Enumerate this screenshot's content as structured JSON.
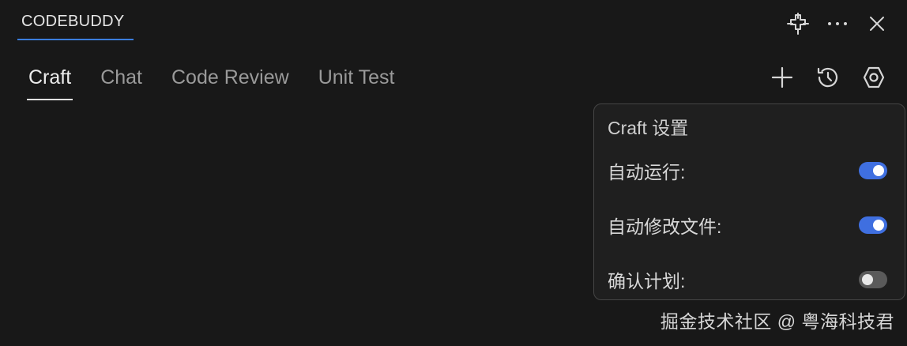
{
  "panel": {
    "title": "CODEBUDDY",
    "header_actions": [
      {
        "name": "agent-icon"
      },
      {
        "name": "more-icon"
      },
      {
        "name": "close-icon"
      }
    ]
  },
  "tabs": [
    {
      "label": "Craft",
      "active": true
    },
    {
      "label": "Chat",
      "active": false
    },
    {
      "label": "Code Review",
      "active": false
    },
    {
      "label": "Unit Test",
      "active": false
    }
  ],
  "toolbar": {
    "actions": [
      "add-icon",
      "history-icon",
      "settings-icon"
    ]
  },
  "settings_popup": {
    "title": "Craft 设置",
    "items": [
      {
        "label": "自动运行:",
        "enabled": true
      },
      {
        "label": "自动修改文件:",
        "enabled": true
      },
      {
        "label": "确认计划:",
        "enabled": false
      }
    ]
  },
  "watermark": "掘金技术社区 @ 粤海科技君",
  "colors": {
    "background": "#181818",
    "accent": "#3b7ddd",
    "toggle_on": "#3f6fe0",
    "toggle_off": "#5a5a5a"
  }
}
